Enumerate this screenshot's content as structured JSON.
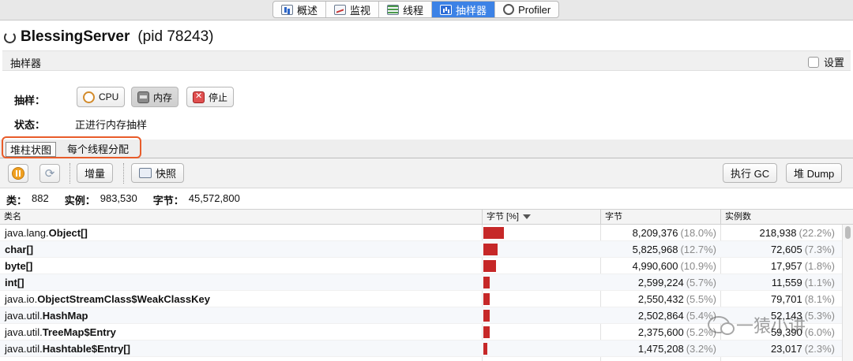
{
  "top_tabs": [
    {
      "label": "概述",
      "icon": "overview-icon"
    },
    {
      "label": "监视",
      "icon": "monitor-icon"
    },
    {
      "label": "线程",
      "icon": "threads-icon"
    },
    {
      "label": "抽样器",
      "icon": "sampler-icon",
      "active": true
    },
    {
      "label": "Profiler",
      "icon": "profiler-icon"
    }
  ],
  "app": {
    "name": "BlessingServer",
    "pid": "(pid 78243)"
  },
  "section": {
    "title": "抽样器",
    "settings_label": "设置"
  },
  "sample": {
    "label": "抽样：",
    "cpu_label": "CPU",
    "memory_label": "内存",
    "stop_label": "停止",
    "status_label": "状态：",
    "status_value": "正进行内存抽样"
  },
  "sub_tabs": [
    {
      "label": "堆柱状图",
      "active": true
    },
    {
      "label": "每个线程分配"
    }
  ],
  "toolbar": {
    "delta_label": "增量",
    "snapshot_label": "快照",
    "gc_label": "执行 GC",
    "dump_label": "堆 Dump"
  },
  "summary": {
    "classes_label": "类：",
    "classes": "882",
    "instances_label": "实例：",
    "instances": "983,530",
    "bytes_label": "字节：",
    "bytes": "45,572,800"
  },
  "table": {
    "headers": [
      "类名",
      "字节 [%]",
      "字节",
      "实例数"
    ],
    "rows": [
      {
        "pkg": "java.lang.",
        "cls": "Object[]",
        "bytes": "8,209,376",
        "bytes_pct": "(18.0%)",
        "bar_pct": 18.0,
        "inst": "218,938",
        "inst_pct": "(22.2%)"
      },
      {
        "pkg": "",
        "cls": "char[]",
        "bytes": "5,825,968",
        "bytes_pct": "(12.7%)",
        "bar_pct": 12.7,
        "inst": "72,605",
        "inst_pct": "(7.3%)"
      },
      {
        "pkg": "",
        "cls": "byte[]",
        "bytes": "4,990,600",
        "bytes_pct": "(10.9%)",
        "bar_pct": 10.9,
        "inst": "17,957",
        "inst_pct": "(1.8%)"
      },
      {
        "pkg": "",
        "cls": "int[]",
        "bytes": "2,599,224",
        "bytes_pct": "(5.7%)",
        "bar_pct": 5.7,
        "inst": "11,559",
        "inst_pct": "(1.1%)"
      },
      {
        "pkg": "java.io.",
        "cls": "ObjectStreamClass$WeakClassKey",
        "bytes": "2,550,432",
        "bytes_pct": "(5.5%)",
        "bar_pct": 5.5,
        "inst": "79,701",
        "inst_pct": "(8.1%)"
      },
      {
        "pkg": "java.util.",
        "cls": "HashMap",
        "bytes": "2,502,864",
        "bytes_pct": "(5.4%)",
        "bar_pct": 5.4,
        "inst": "52,143",
        "inst_pct": "(5.3%)"
      },
      {
        "pkg": "java.util.",
        "cls": "TreeMap$Entry",
        "bytes": "2,375,600",
        "bytes_pct": "(5.2%)",
        "bar_pct": 5.2,
        "inst": "59,390",
        "inst_pct": "(6.0%)"
      },
      {
        "pkg": "java.util.",
        "cls": "Hashtable$Entry[]",
        "bytes": "1,475,208",
        "bytes_pct": "(3.2%)",
        "bar_pct": 3.2,
        "inst": "23,017",
        "inst_pct": "(2.3%)"
      }
    ]
  },
  "watermark": {
    "text": "一猿小讲"
  },
  "colors": {
    "active_tab": "#3c82e6",
    "bar": "#c62828",
    "highlight_box": "#e85c2a"
  }
}
